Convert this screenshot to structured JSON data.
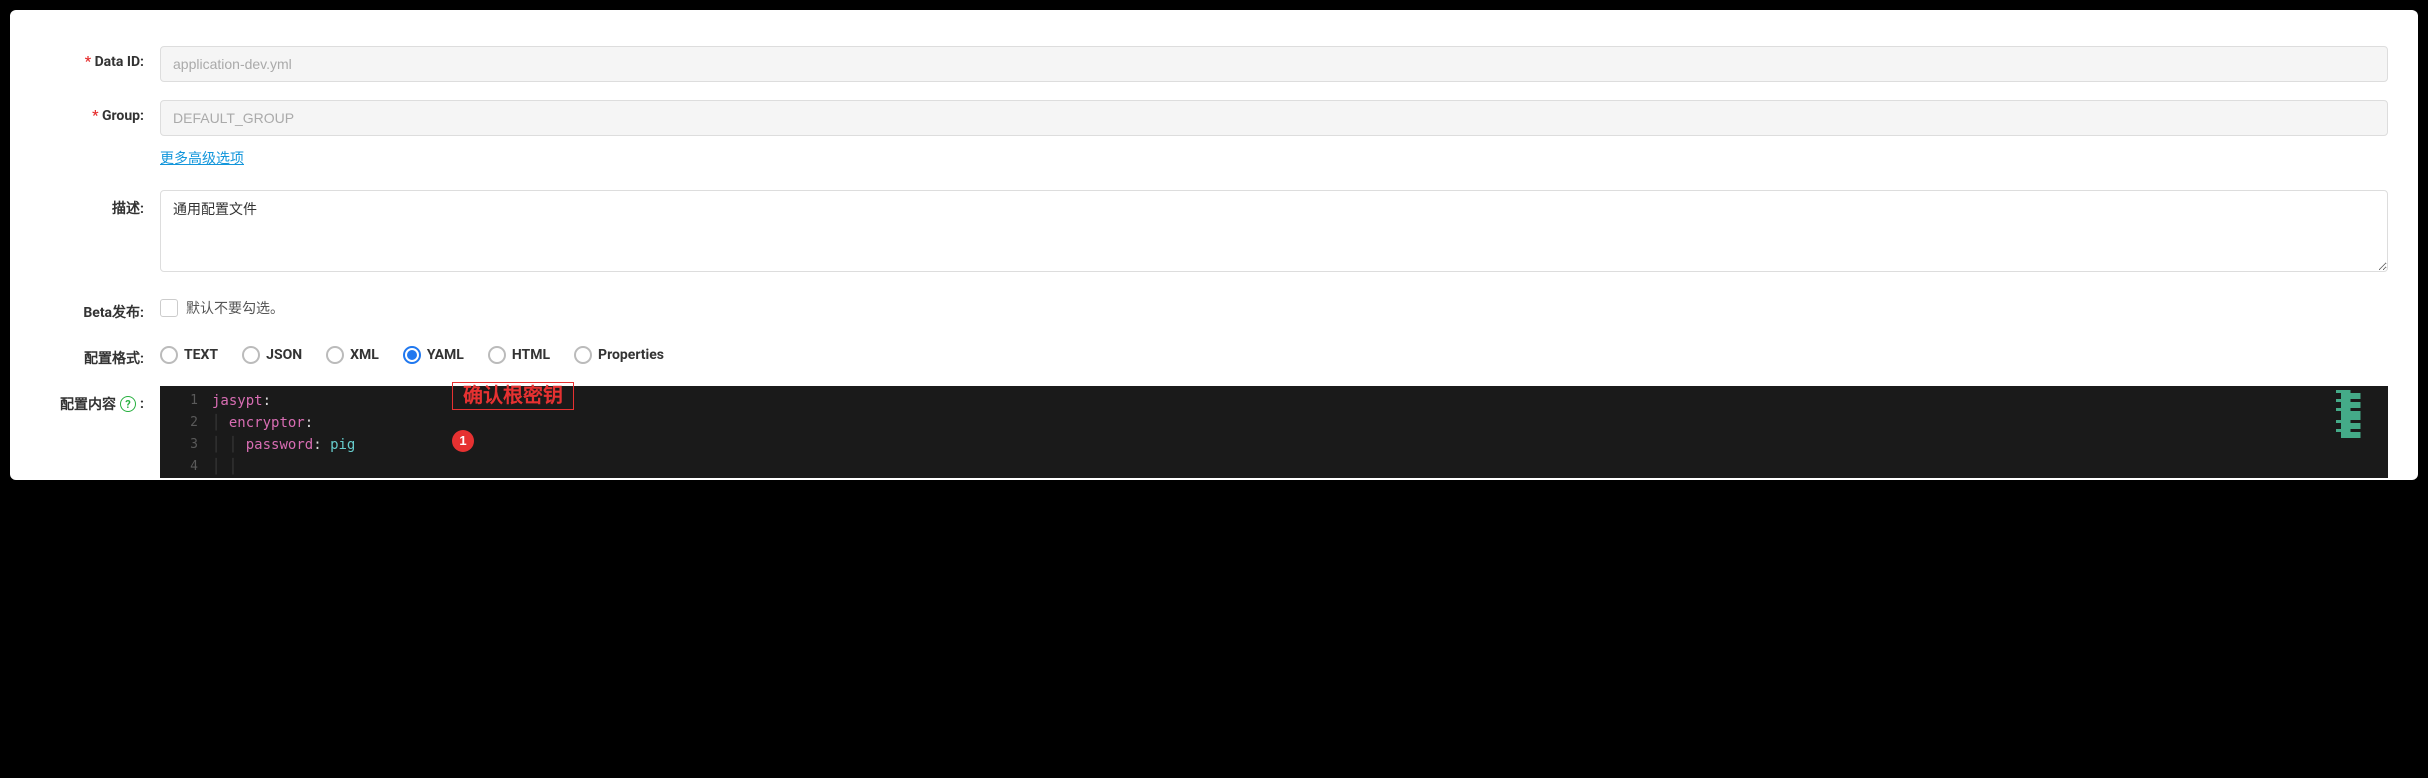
{
  "form": {
    "data_id": {
      "label": "Data ID:",
      "value": "application-dev.yml"
    },
    "group": {
      "label": "Group:",
      "value": "DEFAULT_GROUP"
    },
    "advanced_link": "更多高级选项",
    "description": {
      "label": "描述:",
      "value": "通用配置文件"
    },
    "beta": {
      "label": "Beta发布:",
      "hint": "默认不要勾选。"
    },
    "format": {
      "label": "配置格式:",
      "options": [
        "TEXT",
        "JSON",
        "XML",
        "YAML",
        "HTML",
        "Properties"
      ],
      "selected": "YAML"
    },
    "content": {
      "label": "配置内容"
    }
  },
  "annotation": {
    "box_text": "确认根密钥",
    "badge": "1"
  },
  "code": {
    "lines": [
      {
        "num": "1",
        "indent": 0,
        "key": "jasypt",
        "val": ""
      },
      {
        "num": "2",
        "indent": 1,
        "key": "encryptor",
        "val": ""
      },
      {
        "num": "3",
        "indent": 2,
        "key": "password",
        "val": "pig"
      },
      {
        "num": "4",
        "indent": 2,
        "key": "",
        "val": ""
      }
    ]
  }
}
